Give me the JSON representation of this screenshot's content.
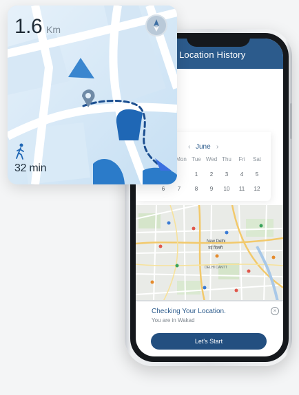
{
  "app": {
    "header_title": "Location History"
  },
  "map_card": {
    "distance_value": "1.6",
    "distance_unit": "Km",
    "duration": "32 min"
  },
  "calendar": {
    "month": "June",
    "prev_arrow": "‹",
    "next_arrow": "›",
    "weekdays": [
      "Mon",
      "Tue",
      "Wed",
      "Thu",
      "Fri",
      "Sat"
    ],
    "week1": [
      "1",
      "2",
      "3",
      "4",
      "5"
    ],
    "week2": [
      "6",
      "7",
      "8",
      "9",
      "10",
      "11",
      "12"
    ]
  },
  "location_panel": {
    "title": "Checking Your Location.",
    "subtitle": "You are in Wakad",
    "close_symbol": "×",
    "start_button": "Let's Start"
  },
  "map_labels": {
    "city_label_1": "New Delhi",
    "city_label_2": "नई दिल्ली",
    "area_label": "DELHI CANTT"
  },
  "colors": {
    "brand_blue": "#2c5b8c",
    "route_blue": "#1f5fa8",
    "map_light_blue": "#cfe4f5"
  }
}
